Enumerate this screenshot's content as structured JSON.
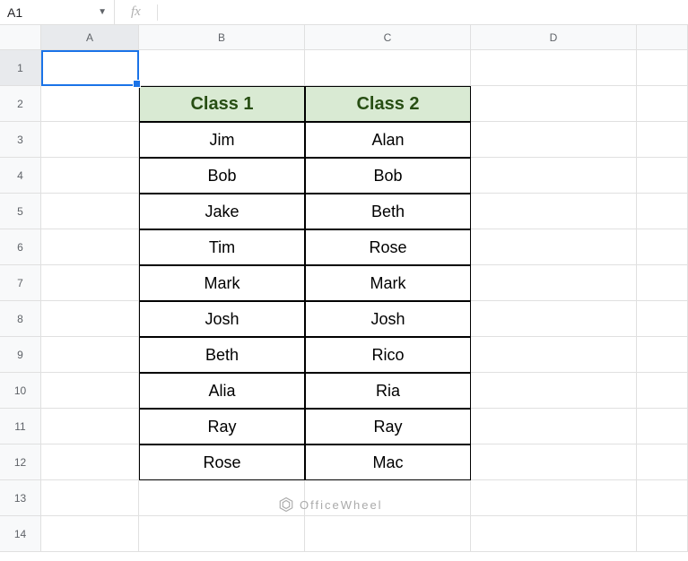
{
  "nameBox": "A1",
  "fxLabel": "fx",
  "formulaValue": "",
  "columns": [
    "A",
    "B",
    "C",
    "D",
    ""
  ],
  "rows": [
    "1",
    "2",
    "3",
    "4",
    "5",
    "6",
    "7",
    "8",
    "9",
    "10",
    "11",
    "12",
    "13",
    "14"
  ],
  "headers": {
    "col1": "Class 1",
    "col2": "Class 2"
  },
  "data": [
    {
      "c1": "Jim",
      "c2": "Alan"
    },
    {
      "c1": "Bob",
      "c2": "Bob"
    },
    {
      "c1": "Jake",
      "c2": "Beth"
    },
    {
      "c1": "Tim",
      "c2": "Rose"
    },
    {
      "c1": "Mark",
      "c2": "Mark"
    },
    {
      "c1": "Josh",
      "c2": "Josh"
    },
    {
      "c1": "Beth",
      "c2": "Rico"
    },
    {
      "c1": "Alia",
      "c2": "Ria"
    },
    {
      "c1": "Ray",
      "c2": "Ray"
    },
    {
      "c1": "Rose",
      "c2": "Mac"
    }
  ],
  "watermark": "OfficeWheel"
}
